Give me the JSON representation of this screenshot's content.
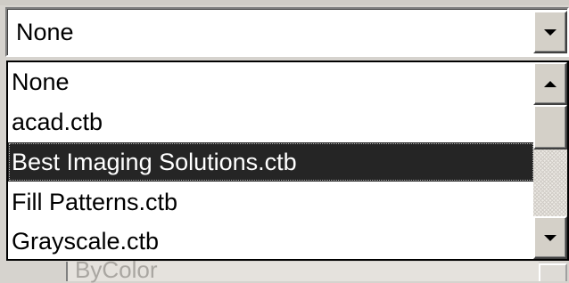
{
  "combo": {
    "selected_value": "None",
    "button_icon": "chevron-down-icon"
  },
  "dropdown": {
    "items": [
      {
        "label": "None"
      },
      {
        "label": "acad.ctb"
      },
      {
        "label": "Best Imaging Solutions.ctb",
        "selected": true
      },
      {
        "label": "Fill Patterns.ctb"
      },
      {
        "label": "Grayscale.ctb"
      }
    ]
  },
  "scrollbar": {
    "up_icon": "arrow-up-icon",
    "down_icon": "arrow-down-icon"
  },
  "background_field": {
    "value": "ByColor"
  },
  "colors": {
    "selection_bg": "#252525",
    "selection_text": "#ffffff",
    "dialog_bg": "#d6d3ce"
  }
}
